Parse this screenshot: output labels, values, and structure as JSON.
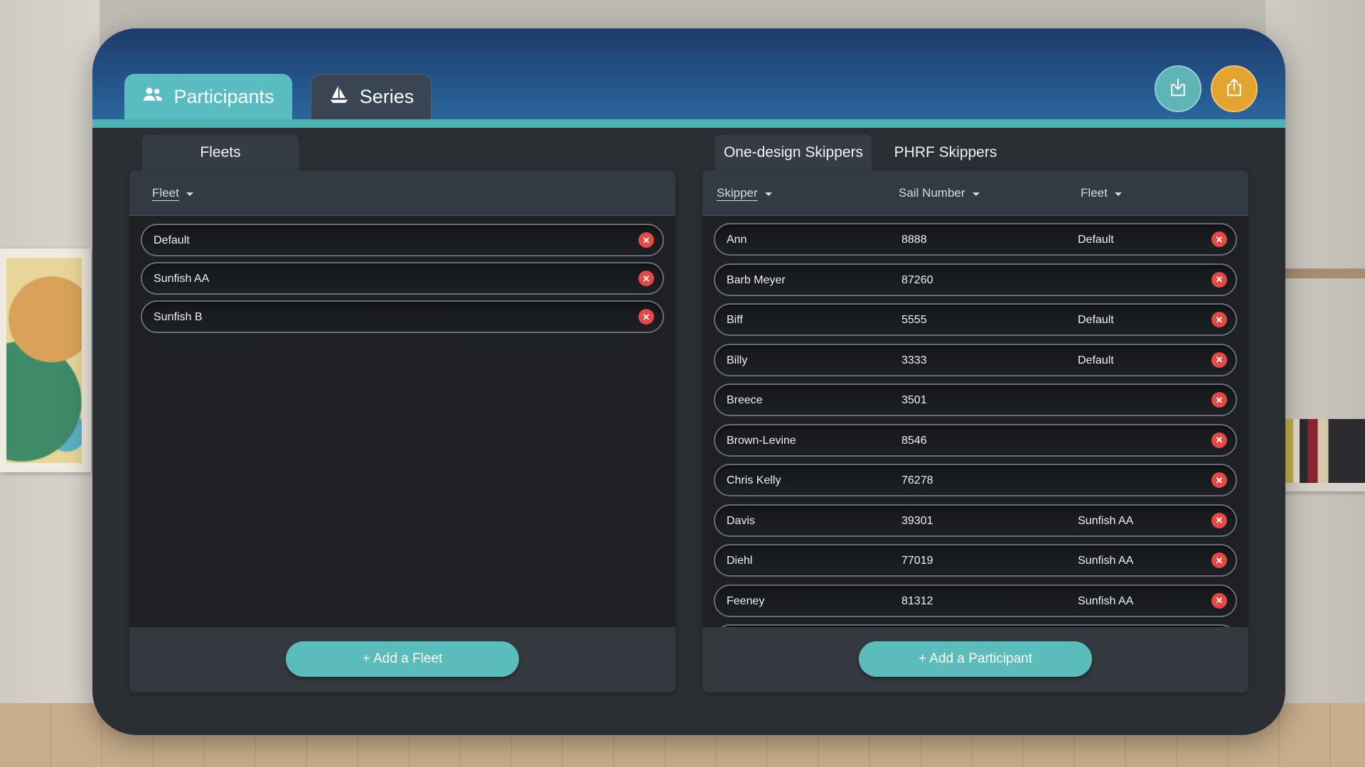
{
  "tabs": {
    "participants": "Participants",
    "series": "Series"
  },
  "fleets_panel": {
    "subtab": "Fleets",
    "column": "Fleet",
    "rows": [
      "Default",
      "Sunfish AA",
      "Sunfish B"
    ],
    "add_label": "+ Add a Fleet"
  },
  "skippers_panel": {
    "subtab_onedesign": "One-design Skippers",
    "subtab_phrf": "PHRF Skippers",
    "columns": {
      "skipper": "Skipper",
      "sail_number": "Sail Number",
      "fleet": "Fleet"
    },
    "rows": [
      {
        "skipper": "Ann",
        "sail": "8888",
        "fleet": "Default"
      },
      {
        "skipper": "Barb Meyer",
        "sail": "87260",
        "fleet": ""
      },
      {
        "skipper": "Biff",
        "sail": "5555",
        "fleet": "Default"
      },
      {
        "skipper": "Billy",
        "sail": "3333",
        "fleet": "Default"
      },
      {
        "skipper": "Breece",
        "sail": "3501",
        "fleet": ""
      },
      {
        "skipper": "Brown-Levine",
        "sail": "8546",
        "fleet": ""
      },
      {
        "skipper": "Chris Kelly",
        "sail": "76278",
        "fleet": ""
      },
      {
        "skipper": "Davis",
        "sail": "39301",
        "fleet": "Sunfish AA"
      },
      {
        "skipper": "Diehl",
        "sail": "77019",
        "fleet": "Sunfish AA"
      },
      {
        "skipper": "Feeney",
        "sail": "81312",
        "fleet": "Sunfish AA"
      }
    ],
    "add_label": "+ Add a Participant"
  },
  "icons": {
    "participants": "people-icon",
    "series": "sailboat-icon",
    "import": "import-icon",
    "share": "share-icon",
    "delete": "close-circle-icon"
  },
  "colors": {
    "accent_teal": "#59bcc0",
    "share_orange": "#e5a430",
    "delete_red": "#e34a43"
  }
}
